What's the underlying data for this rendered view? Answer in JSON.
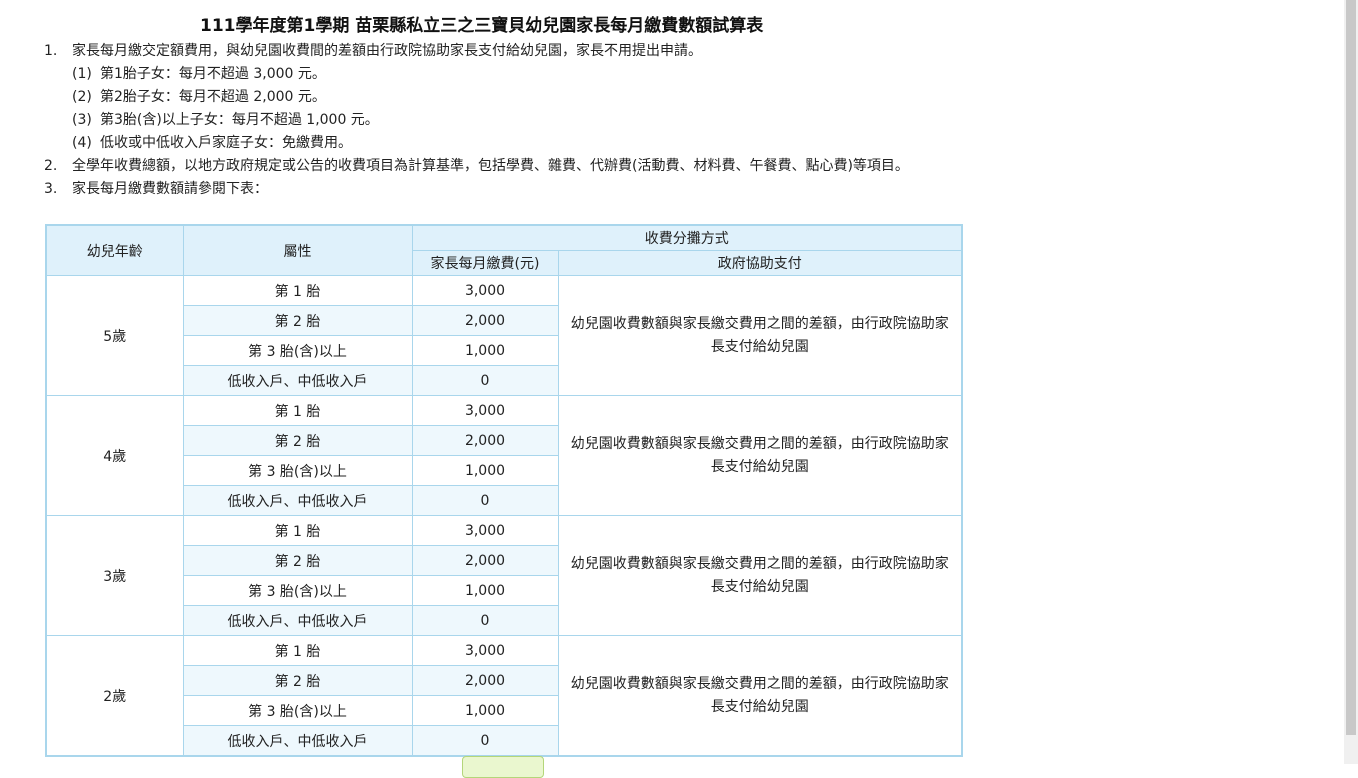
{
  "title": "111學年度第1學期 苗栗縣私立三之三寶貝幼兒園家長每月繳費數額試算表",
  "notes": [
    {
      "num": "1.",
      "text": "家長每月繳交定額費用，與幼兒園收費間的差額由行政院協助家長支付給幼兒園，家長不用提出申請。"
    },
    {
      "num": "2.",
      "text": "全學年收費總額，以地方政府規定或公告的收費項目為計算基準，包括學費、雜費、代辦費(活動費、材料費、午餐費、點心費)等項目。"
    },
    {
      "num": "3.",
      "text": "家長每月繳費數額請參閱下表："
    }
  ],
  "subnotes": [
    {
      "num": "(1)",
      "text": "第1胎子女：每月不超過 3,000 元。"
    },
    {
      "num": "(2)",
      "text": "第2胎子女：每月不超過 2,000 元。"
    },
    {
      "num": "(3)",
      "text": "第3胎(含)以上子女：每月不超過 1,000 元。"
    },
    {
      "num": "(4)",
      "text": "低收或中低收入戶家庭子女：免繳費用。"
    }
  ],
  "table": {
    "headers": {
      "age": "幼兒年齡",
      "category": "屬性",
      "split": "收費分攤方式",
      "parent": "家長每月繳費(元)",
      "gov": "政府協助支付"
    },
    "gov_text": "幼兒園收費數額與家長繳交費用之間的差額，由行政院協助家長支付給幼兒園",
    "groups": [
      {
        "age": "5歲",
        "rows": [
          {
            "category": "第 1 胎",
            "amount": "3,000"
          },
          {
            "category": "第 2 胎",
            "amount": "2,000"
          },
          {
            "category": "第 3 胎(含)以上",
            "amount": "1,000"
          },
          {
            "category": "低收入戶、中低收入戶",
            "amount": "0"
          }
        ]
      },
      {
        "age": "4歲",
        "rows": [
          {
            "category": "第 1 胎",
            "amount": "3,000"
          },
          {
            "category": "第 2 胎",
            "amount": "2,000"
          },
          {
            "category": "第 3 胎(含)以上",
            "amount": "1,000"
          },
          {
            "category": "低收入戶、中低收入戶",
            "amount": "0"
          }
        ]
      },
      {
        "age": "3歲",
        "rows": [
          {
            "category": "第 1 胎",
            "amount": "3,000"
          },
          {
            "category": "第 2 胎",
            "amount": "2,000"
          },
          {
            "category": "第 3 胎(含)以上",
            "amount": "1,000"
          },
          {
            "category": "低收入戶、中低收入戶",
            "amount": "0"
          }
        ]
      },
      {
        "age": "2歲",
        "rows": [
          {
            "category": "第 1 胎",
            "amount": "3,000"
          },
          {
            "category": "第 2 胎",
            "amount": "2,000"
          },
          {
            "category": "第 3 胎(含)以上",
            "amount": "1,000"
          },
          {
            "category": "低收入戶、中低收入戶",
            "amount": "0"
          }
        ]
      }
    ]
  }
}
